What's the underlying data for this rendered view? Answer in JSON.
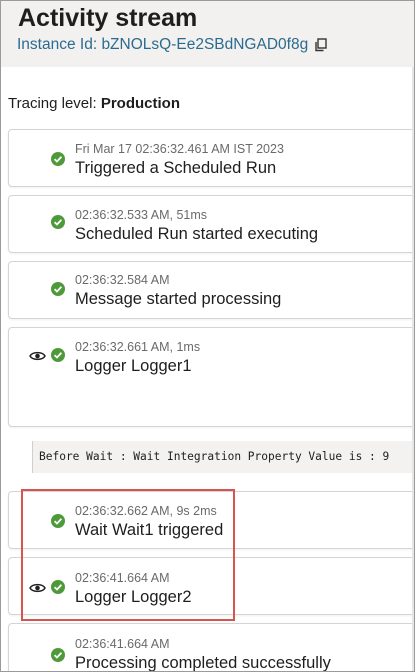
{
  "header": {
    "title": "Activity stream",
    "instance_label": "Instance Id: bZNOLsQ-Ee2SBdNGAD0f8g"
  },
  "tracing": {
    "label": "Tracing level:",
    "value": "Production"
  },
  "activities": [
    {
      "meta": "Fri Mar 17 02:36:32.461 AM IST 2023",
      "label": "Triggered a Scheduled Run",
      "status": "success",
      "has_eye": false
    },
    {
      "meta": "02:36:32.533 AM, 51ms",
      "label": "Scheduled Run started executing",
      "status": "success",
      "has_eye": false
    },
    {
      "meta": "02:36:32.584 AM",
      "label": "Message started processing",
      "status": "success",
      "has_eye": false
    },
    {
      "meta": "02:36:32.661 AM, 1ms",
      "label": "Logger Logger1",
      "status": "success",
      "has_eye": true
    },
    {
      "meta": "02:36:32.662 AM, 9s 2ms",
      "label": "Wait Wait1 triggered",
      "status": "success",
      "has_eye": false
    },
    {
      "meta": "02:36:41.664 AM",
      "label": "Logger Logger2",
      "status": "success",
      "has_eye": true
    },
    {
      "meta": "02:36:41.664 AM",
      "label": "Processing completed successfully",
      "status": "success",
      "has_eye": false
    }
  ],
  "logger1_payload": "Before Wait : Wait Integration Property Value is : 9",
  "colors": {
    "success": "#4e9a3a",
    "link": "#2b6b8f",
    "highlight": "#d9534f",
    "header_bg": "#f2f1ef"
  },
  "icons": {
    "copy": "copy-icon",
    "status": "check-circle-icon",
    "view": "eye-icon"
  }
}
